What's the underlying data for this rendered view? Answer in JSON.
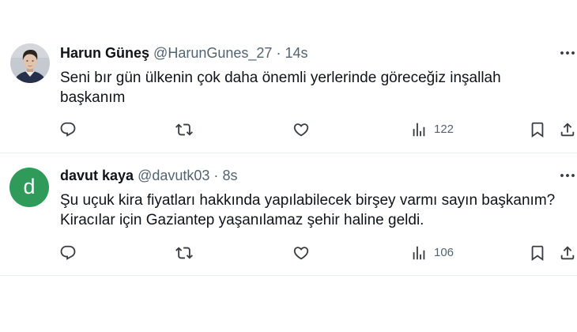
{
  "colors": {
    "text": "#0f1419",
    "secondary": "#536471",
    "divider": "#e7ecef",
    "icon": "#3a3e42"
  },
  "action_icons": [
    "reply-icon",
    "retweet-icon",
    "like-icon",
    "views-icon",
    "bookmark-icon",
    "share-icon",
    "more-icon"
  ],
  "tweets": [
    {
      "name": "Harun Güneş",
      "handle": "@HarunGunes_27",
      "separator": "·",
      "time": "14s",
      "text_lines": [
        "Seni bır gün ülkenin çok daha önemli yerlerinde göreceğiz inşallah",
        "başkanım"
      ],
      "views": "122"
    },
    {
      "name": "davut kaya",
      "handle": "@davutk03",
      "separator": "·",
      "time": "8s",
      "avatar": {
        "letter": "d",
        "color": "#2f9a5a"
      },
      "text_lines": [
        "Şu uçuk kira fiyatları hakkında yapılabilecek birşey varmı sayın başkanım?",
        "Kiracılar için Gaziantep yaşanılamaz şehir haline geldi."
      ],
      "views": "106"
    }
  ]
}
